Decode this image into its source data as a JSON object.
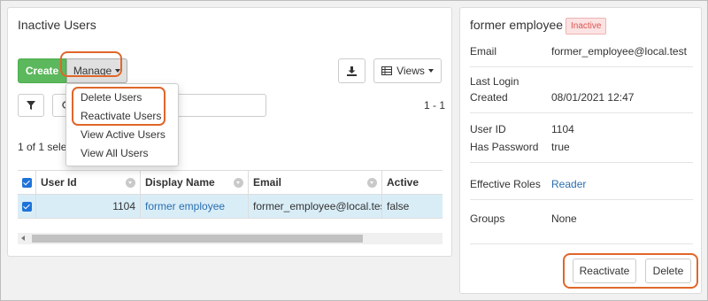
{
  "list": {
    "title": "Inactive Users",
    "toolbar": {
      "create_label": "Create",
      "manage_label": "Manage",
      "export_icon": "download-icon",
      "views_label": "Views",
      "views_icon": "grid-icon",
      "filter_icon": "filter-icon",
      "search_placeholder": "",
      "search_icon": "search-icon"
    },
    "pagination": "1 - 1",
    "selection_status": "1 of 1 selec",
    "manage_menu": [
      "Delete Users",
      "Reactivate Users",
      "View Active Users",
      "View All Users"
    ],
    "columns": [
      "User Id",
      "Display Name",
      "Email",
      "Active"
    ],
    "rows": [
      {
        "user_id": "1104",
        "display_name": "former employee",
        "email": "former_employee@local.test",
        "active": "false",
        "selected": true
      }
    ]
  },
  "detail": {
    "name": "former employee",
    "status_badge": "Inactive",
    "fields": {
      "email_label": "Email",
      "email_value": "former_employee@local.test",
      "last_login_label": "Last Login",
      "created_label": "Created",
      "created_value": "08/01/2021 12:47",
      "user_id_label": "User ID",
      "user_id_value": "1104",
      "has_password_label": "Has Password",
      "has_password_value": "true",
      "roles_label": "Effective Roles",
      "roles_value": "Reader",
      "groups_label": "Groups",
      "groups_value": "None"
    },
    "actions": {
      "reactivate_label": "Reactivate",
      "delete_label": "Delete"
    }
  },
  "colors": {
    "highlight": "#e0662a",
    "create_button": "#5cb85c",
    "selected_row": "#d9edf7",
    "link": "#2a6fb0",
    "inactive_badge": "#d9534f"
  }
}
